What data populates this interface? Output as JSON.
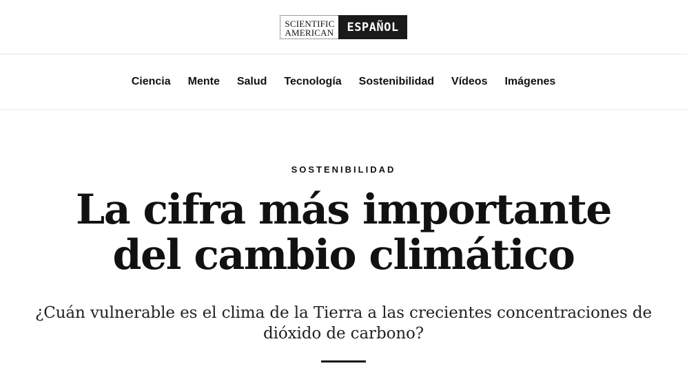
{
  "logo": {
    "line1": "SCIENTIFIC",
    "line2": "AMERICAN",
    "edition": "ESPAÑOL"
  },
  "nav": {
    "items": [
      {
        "label": "Ciencia"
      },
      {
        "label": "Mente"
      },
      {
        "label": "Salud"
      },
      {
        "label": "Tecnología"
      },
      {
        "label": "Sostenibilidad"
      },
      {
        "label": "Vídeos"
      },
      {
        "label": "Imágenes"
      }
    ]
  },
  "article": {
    "kicker": "SOSTENIBILIDAD",
    "headline": "La cifra más importante del cambio climático",
    "dek": "¿Cuán vulnerable es el clima de la Tierra a las crecientes concentraciones de dióxido de carbono?"
  }
}
